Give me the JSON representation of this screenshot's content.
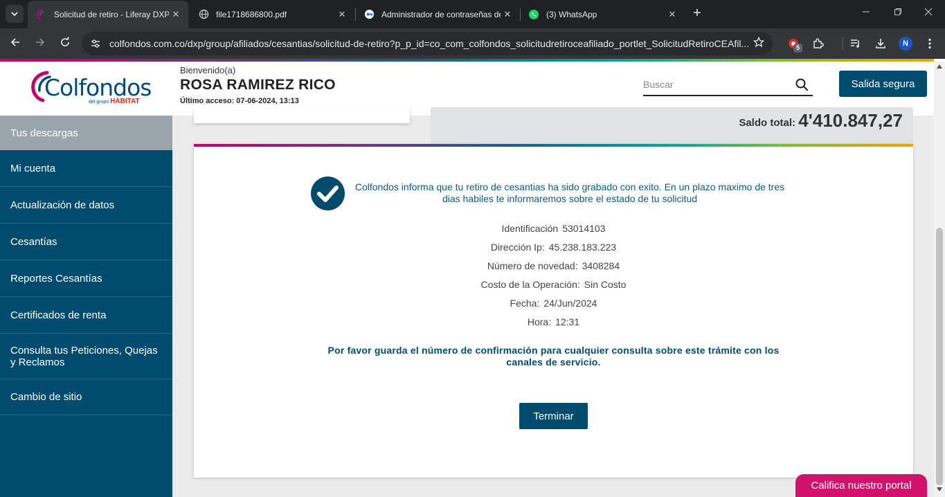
{
  "browser": {
    "tabs": [
      {
        "title": "Solicitud de retiro - Liferay DXP",
        "icon": "liferay-favicon-icon",
        "active": true
      },
      {
        "title": "file1718686800.pdf",
        "icon": "globe-icon",
        "active": false
      },
      {
        "title": "Administrador de contraseñas de",
        "icon": "password-manager-icon",
        "active": false
      },
      {
        "title": "(3) WhatsApp",
        "icon": "whatsapp-icon",
        "active": false
      }
    ],
    "tab_close": "✕",
    "new_tab": "+",
    "url": "colfondos.com.co/dxp/group/afiliados/cesantias/solicitud-de-retiro?p_p_id=co_com_colfondos_solicitudretiroceafiliado_portlet_SolicitudRetiroCEAfil...",
    "extension_badge": "5",
    "profile_initial": "N"
  },
  "header": {
    "logo_text": "Colfondos",
    "logo_sub_prefix": "del grupo",
    "logo_sub_brand": "HABITAT",
    "welcome": "Bienvenido(a)",
    "user_name": "ROSA RAMIREZ RICO",
    "last_access": "Último acceso: 07-06-2024, 13:13",
    "search_placeholder": "Buscar",
    "logout_label": "Salida segura"
  },
  "sidebar": {
    "items": [
      {
        "label": "Tus descargas",
        "highlight": true
      },
      {
        "label": "Mi cuenta"
      },
      {
        "label": "Actualización de datos"
      },
      {
        "label": "Cesantías"
      },
      {
        "label": "Reportes Cesantías"
      },
      {
        "label": "Certificados de renta"
      },
      {
        "label": "Consulta tus Peticiones, Quejas y Reclamos"
      },
      {
        "label": "Cambio de sitio"
      }
    ]
  },
  "balance": {
    "label": "Saldo total:",
    "value": "4'410.847,27"
  },
  "confirmation": {
    "message": "Colfondos informa que tu retiro de cesantias ha sido grabado con exito. En un plazo maximo de tres dias habiles te informaremos sobre el estado de tu solicitud",
    "details": [
      {
        "label": "Identificación",
        "value": "53014103"
      },
      {
        "label": "Dirección Ip:",
        "value": "45.238.183.223"
      },
      {
        "label": "Número de novedad:",
        "value": "3408284"
      },
      {
        "label": "Costo de la Operación:",
        "value": "Sin Costo"
      },
      {
        "label": "Fecha:",
        "value": "24/Jun/2024"
      },
      {
        "label": "Hora:",
        "value": "12:31"
      }
    ],
    "notice": "Por favor guarda el número de confirmación para cualquier consulta sobre este trámite con los canales de servicio.",
    "finish_label": "Terminar"
  },
  "rate_portal_label": "Califica nuestro portal",
  "colors": {
    "brand_blue": "#004b6e",
    "brand_pink": "#d3126e",
    "message_blue": "#0a5b85"
  }
}
